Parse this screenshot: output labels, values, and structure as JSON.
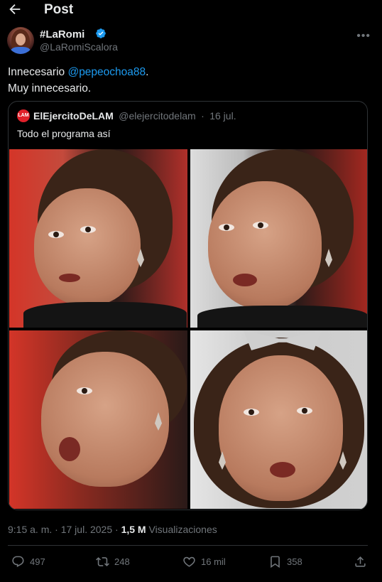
{
  "header": {
    "title": "Post"
  },
  "author": {
    "name": "#LaRomi",
    "handle": "@LaRomiScalora"
  },
  "tweet": {
    "line1_prefix": "Innecesario ",
    "mention": "@pepeochoa88",
    "line1_suffix": ".",
    "line2": "Muy innecesario."
  },
  "quote": {
    "logo_text": "LAM",
    "name": "ElEjercitoDeLAM",
    "handle": "@elejercitodelam",
    "separator": "·",
    "date": "16 jul.",
    "text": "Todo el programa así"
  },
  "meta": {
    "time": "9:15 a. m.",
    "separator": "·",
    "date": "17 jul. 2025",
    "views_count": "1,5 M",
    "views_label": "Visualizaciones"
  },
  "actions": {
    "replies": "497",
    "reposts": "248",
    "likes": "16 mil",
    "bookmarks": "358"
  },
  "colors": {
    "accent": "#1d9bf0",
    "muted": "#71767b",
    "border": "#2f3336"
  }
}
